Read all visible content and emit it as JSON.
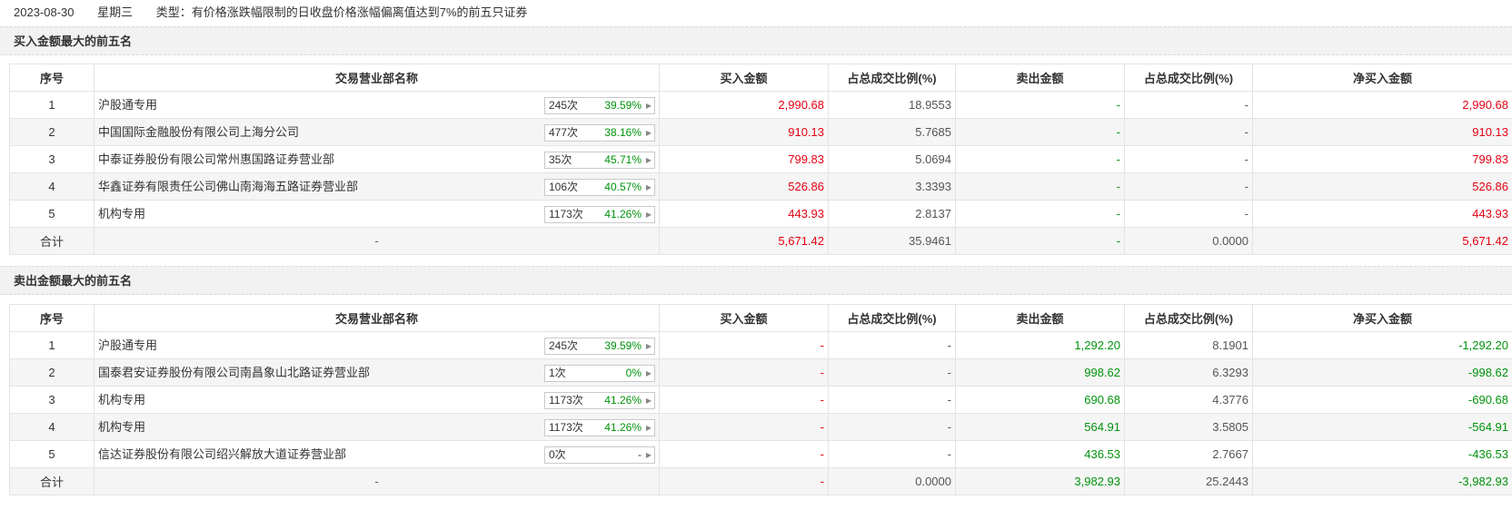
{
  "header": {
    "date": "2023-08-30",
    "weekday": "星期三",
    "type": "类型：有价格涨跌幅限制的日收盘价格涨幅偏离值达到7%的前五只证券"
  },
  "buy_section": {
    "title": "买入金额最大的前五名",
    "columns": [
      "序号",
      "交易营业部名称",
      "买入金额",
      "占总成交比例(%)",
      "卖出金额",
      "占总成交比例(%)",
      "净买入金额"
    ],
    "rows": [
      {
        "no": "1",
        "name": "沪股通专用",
        "count": "245次",
        "rate": "39.59%",
        "buy": "2,990.68",
        "buy_pct": "18.9553",
        "sell": "-",
        "sell_pct": "-",
        "net": "2,990.68"
      },
      {
        "no": "2",
        "name": "中国国际金融股份有限公司上海分公司",
        "count": "477次",
        "rate": "38.16%",
        "buy": "910.13",
        "buy_pct": "5.7685",
        "sell": "-",
        "sell_pct": "-",
        "net": "910.13"
      },
      {
        "no": "3",
        "name": "中泰证券股份有限公司常州惠国路证券营业部",
        "count": "35次",
        "rate": "45.71%",
        "buy": "799.83",
        "buy_pct": "5.0694",
        "sell": "-",
        "sell_pct": "-",
        "net": "799.83"
      },
      {
        "no": "4",
        "name": "华鑫证券有限责任公司佛山南海海五路证券营业部",
        "count": "106次",
        "rate": "40.57%",
        "buy": "526.86",
        "buy_pct": "3.3393",
        "sell": "-",
        "sell_pct": "-",
        "net": "526.86"
      },
      {
        "no": "5",
        "name": "机构专用",
        "count": "1173次",
        "rate": "41.26%",
        "buy": "443.93",
        "buy_pct": "2.8137",
        "sell": "-",
        "sell_pct": "-",
        "net": "443.93"
      }
    ],
    "total": {
      "label": "合计",
      "name": "-",
      "buy": "5,671.42",
      "buy_pct": "35.9461",
      "sell": "-",
      "sell_pct": "0.0000",
      "net": "5,671.42"
    }
  },
  "sell_section": {
    "title": "卖出金额最大的前五名",
    "columns": [
      "序号",
      "交易营业部名称",
      "买入金额",
      "占总成交比例(%)",
      "卖出金额",
      "占总成交比例(%)",
      "净买入金额"
    ],
    "rows": [
      {
        "no": "1",
        "name": "沪股通专用",
        "count": "245次",
        "rate": "39.59%",
        "buy": "-",
        "buy_pct": "-",
        "sell": "1,292.20",
        "sell_pct": "8.1901",
        "net": "-1,292.20"
      },
      {
        "no": "2",
        "name": "国泰君安证券股份有限公司南昌象山北路证券营业部",
        "count": "1次",
        "rate": "0%",
        "buy": "-",
        "buy_pct": "-",
        "sell": "998.62",
        "sell_pct": "6.3293",
        "net": "-998.62"
      },
      {
        "no": "3",
        "name": "机构专用",
        "count": "1173次",
        "rate": "41.26%",
        "buy": "-",
        "buy_pct": "-",
        "sell": "690.68",
        "sell_pct": "4.3776",
        "net": "-690.68"
      },
      {
        "no": "4",
        "name": "机构专用",
        "count": "1173次",
        "rate": "41.26%",
        "buy": "-",
        "buy_pct": "-",
        "sell": "564.91",
        "sell_pct": "3.5805",
        "net": "-564.91"
      },
      {
        "no": "5",
        "name": "信达证券股份有限公司绍兴解放大道证券营业部",
        "count": "0次",
        "rate": "-",
        "buy": "-",
        "buy_pct": "-",
        "sell": "436.53",
        "sell_pct": "2.7667",
        "net": "-436.53"
      }
    ],
    "total": {
      "label": "合计",
      "name": "-",
      "buy": "-",
      "buy_pct": "0.0000",
      "sell": "3,982.93",
      "sell_pct": "25.2443",
      "net": "-3,982.93"
    }
  },
  "colors": {
    "up": "#e60012",
    "down": "#00930d"
  },
  "icons": {
    "badge_arrow": "triangle-right-icon"
  }
}
